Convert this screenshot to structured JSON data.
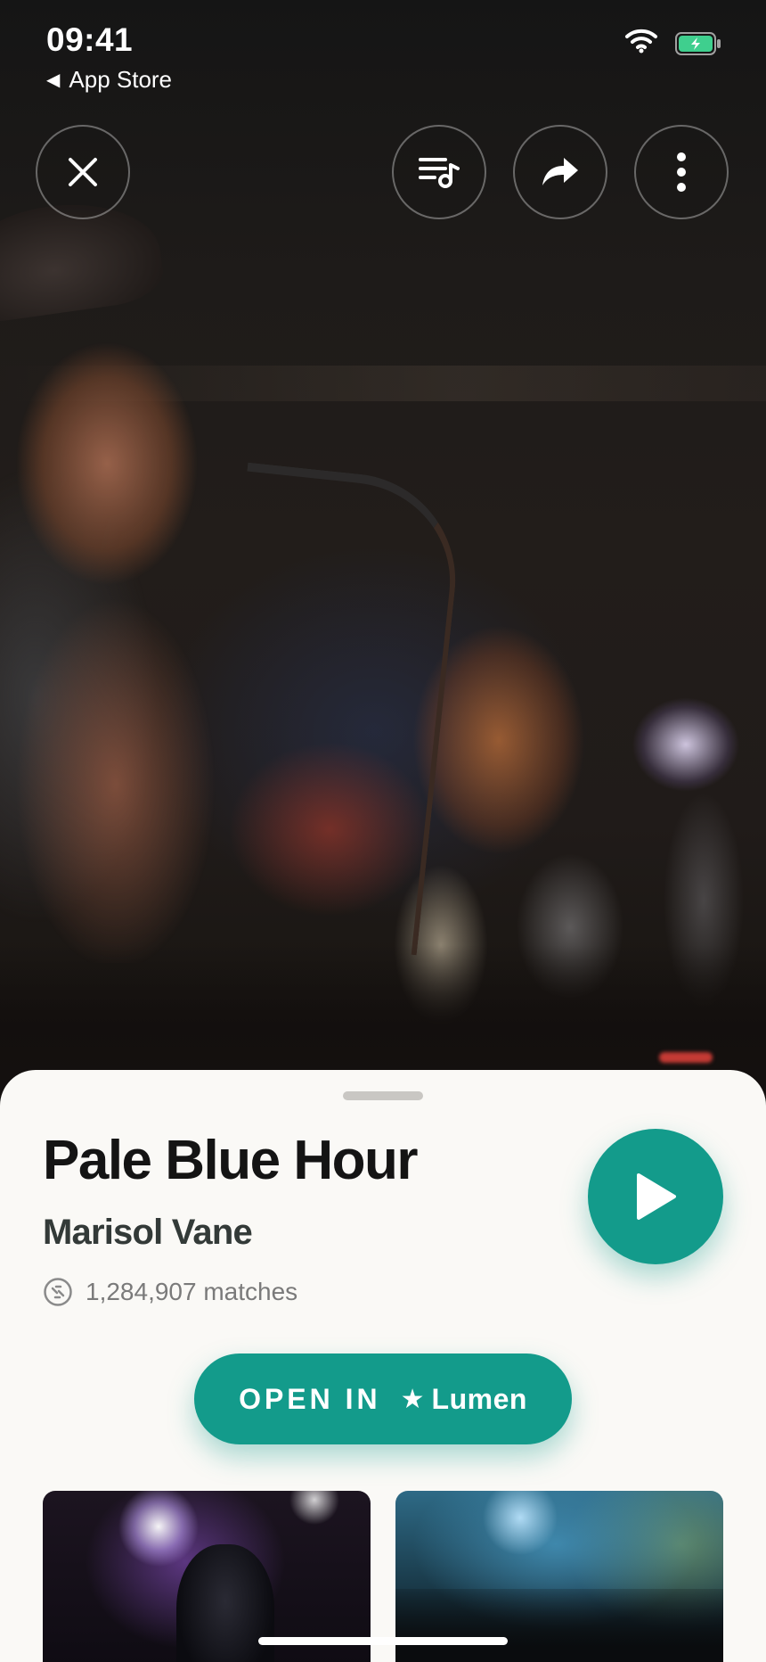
{
  "status_bar": {
    "time": "09:41",
    "back_label": "App Store",
    "back_glyph": "◀",
    "icons": [
      "wifi-icon",
      "battery-charging-icon"
    ],
    "battery_color": "#3fcf8e"
  },
  "top_controls": {
    "close_icon": "close-icon",
    "queue_icon": "playlist-music-icon",
    "share_icon": "share-arrow-icon",
    "more_icon": "more-vertical-icon"
  },
  "song": {
    "title": "Pale Blue Hour",
    "artist": "Marisol Vane",
    "matches": "1,284,907 matches"
  },
  "actions": {
    "open_label": "OPEN IN",
    "star_glyph": "★",
    "app_name": "Lumen",
    "accent_color": "#139b8b"
  },
  "gallery": {
    "thumbnails": [
      "concert-guitarist-photo",
      "crowd-hands-photo"
    ]
  }
}
